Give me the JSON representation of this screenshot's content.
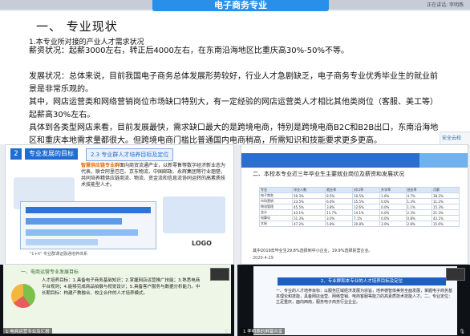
{
  "meeting": {
    "status_text": "正在讲话: 李明燕",
    "title": "电子商务专业"
  },
  "doc": {
    "heading": "一、 专业现状",
    "subheading": "1.本专业所对接的产业人才需求状况",
    "paragraphs": [
      "薪资状况：起薪3000左右，转正后4000左右，在东南沿海地区比重庆高30%-50%不等。",
      "发展状况：总体来说，目前我国电子商务总体发展形势较好，行业人才急剧缺乏，电子商务专业优秀毕业生的就业前景是非常乐观的。",
      "其中，网店运营类和网络营销岗位市场缺口特别大，有一定经验的网店运营类人才相比其他类岗位（客服、美工等）起薪高30%左右。",
      "具体到各类型网店来看，目前发展最快，需求缺口最大的是跨境电商，特别是跨境电商B2C和B2B出口，东南沿海地区和重庆本地需求量都很大。但跨境电商门槛比普通国内电商稍高，所需知识和技能要求更多更高。"
    ],
    "side_chip": "安全云校"
  },
  "slide1": {
    "num": "2",
    "tag": "专业发展的目标",
    "tag2": "2.3 专业群人才培养目标及定位",
    "body_highlight": "智慧供应链专业群",
    "body": "面向商贸流通产业，以新零售等数字经济新业态为代表，联合阿里巴巴、京东物流、中国邮政、永辉集团等行业翘楚，共同培养精供应链商流、物流、资金流和信息流协同运转的高素质技术技能型人才。",
    "footer_logo": "LOGO",
    "caption": "\"1+X\" 专业群课证融通培养体系"
  },
  "slide2": {
    "title": "二、本校本专业近三年毕业生主要就业岗位及薪资和发展状况",
    "table": [
      [
        "专业",
        "毕业人数",
        "就业率",
        "对口率",
        "升学率",
        "创业率",
        "月薪"
      ],
      [
        "电子商务",
        "59.3%",
        "8.5%",
        "10.5%",
        "1.6%",
        "4.7%",
        "38.2%"
      ],
      [
        "市场营销",
        "23.5%",
        "6.0%",
        "15.5%",
        "0.0%",
        "1.3%",
        "11.2%"
      ],
      [
        "物流管理",
        "45.5%",
        "3.8%",
        "12.6%",
        "0.0%",
        "1.1%",
        "15.3%"
      ],
      [
        "会计",
        "43.1%",
        "11.7%",
        "14.1%",
        "0.0%",
        "2.3%",
        "21.3%"
      ],
      [
        "电算化",
        "51.3%",
        "3.0%",
        "7.1%",
        "0.0%",
        "0.8%",
        "42.1%"
      ],
      [
        "文秘",
        "47.2%",
        "5.8%",
        "20.8%",
        "3.0%",
        "2.8%",
        "15.6%"
      ]
    ],
    "note": "其中2019年毕业生29.8%选择到中小企业，19.9%选择民营企业。",
    "date": "2020-4-29"
  },
  "slide3": {
    "title": "一、电商运营专业发展目标",
    "body": "人才培养目标：1.具备电子商务基础知识；2.掌握网店运营推广技能；3.熟悉电商平台规则；4.能够完成商品拍摄与视觉设计；5.具备客户服务与数据分析能力。中长期目标：构建产教融合、校企合作的人才培养模式。",
    "name": "1 电商运营专业及汇报"
  },
  "slide4": {
    "title": "2、专业群和本专业的人才培养目标及定位",
    "body": "一、专业的人才培养目标：以服务区域经济发展为宗旨，培养德智体美劳全面发展，掌握电子商务基本理论和技能，具备网店运营、网络营销、电商客服等能力的高素质技术技能人才。二、专业定位：立足重庆，面向西南，服务电子商务行业企业。",
    "name": "1 李明燕的屏幕共享"
  }
}
